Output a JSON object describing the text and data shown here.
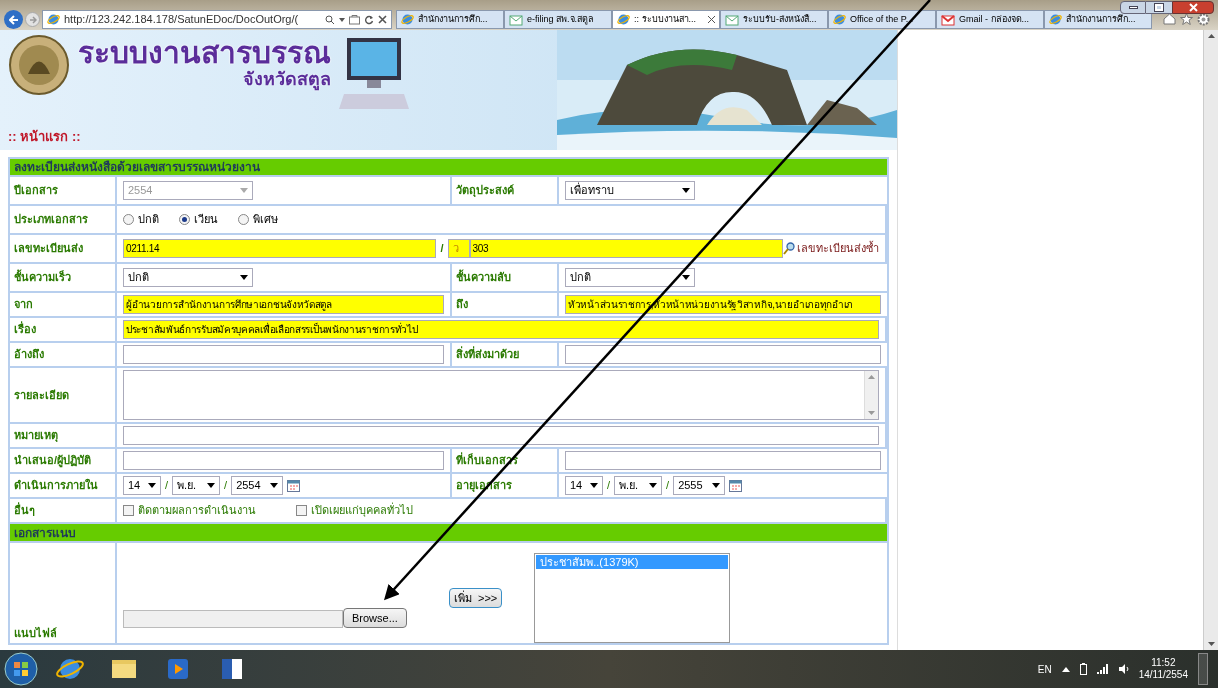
{
  "browser": {
    "address": "http://123.242.184.178/SatunEDoc/DocOutOrg/(",
    "tabs": [
      {
        "label": "สำนักงานการศึก...",
        "selected": false,
        "kind": "ie"
      },
      {
        "label": "e-filing สพ.จ.สตูล",
        "selected": false,
        "kind": "mail"
      },
      {
        "label": ":: ระบบงานสา...",
        "selected": true,
        "kind": "ie"
      },
      {
        "label": "ระบบรับ-ส่งหนังสื...",
        "selected": false,
        "kind": "mail"
      },
      {
        "label": "Office of the P...",
        "selected": false,
        "kind": "ie"
      },
      {
        "label": "Gmail - กล่องจด...",
        "selected": false,
        "kind": "gmail"
      },
      {
        "label": "สำนักงานการศึก...",
        "selected": false,
        "kind": "ie"
      }
    ]
  },
  "header": {
    "title": "ระบบงานสารบรรณ",
    "subtitle": "จังหวัดสตูล",
    "home_link": ":: หน้าแรก ::"
  },
  "form": {
    "title": "ลงทะเบียนส่งหนังสือด้วยเลขสารบรรณหน่วยงาน",
    "rows": [
      {
        "label": "ปีเอกสาร",
        "items": [
          {
            "kind": "select",
            "value": "2554",
            "disabled": true
          }
        ],
        "label2": "วัตถุประสงค์",
        "items2": [
          {
            "kind": "select",
            "value": "เพื่อทราบ",
            "disabled": false
          }
        ]
      },
      {
        "label": "ประเภทเอกสาร",
        "items": [
          {
            "kind": "radio",
            "label": "ปกติ",
            "selected": false
          },
          {
            "kind": "radio",
            "label": "เวียน",
            "selected": true
          },
          {
            "kind": "radio",
            "label": "พิเศษ",
            "selected": false
          }
        ]
      },
      {
        "label": "เลขทะเบียนส่ง",
        "items": [
          {
            "kind": "input",
            "value": "0211.14",
            "highlighted": true
          },
          {
            "kind": "slash",
            "text": "/"
          },
          {
            "kind": "short_input",
            "value": "ว",
            "highlighted": true
          },
          {
            "kind": "input",
            "value": "303",
            "highlighted": true
          },
          {
            "kind": "link",
            "text": "เลขทะเบียนส่งซ้ำ"
          }
        ]
      },
      {
        "label": "ชั้นความเร็ว",
        "items": [
          {
            "kind": "select",
            "value": "ปกติ",
            "disabled": false
          }
        ],
        "label2": "ชั้นความลับ",
        "items2": [
          {
            "kind": "select",
            "value": "ปกติ",
            "disabled": false
          }
        ]
      },
      {
        "label": "จาก",
        "items": [
          {
            "kind": "input",
            "value": "ผู้อำนวยการสำนักงานการศึกษาเอกชนจังหวัดสตูล",
            "highlighted": true
          }
        ],
        "label2": "ถึง",
        "items2": [
          {
            "kind": "input",
            "value": "หัวหน้าส่วนราชการ,หัวหน้าหน่วยงานรัฐวิสาหกิจ,นายอำเภอทุกอำเภ",
            "highlighted": true
          }
        ]
      },
      {
        "label": "เรื่อง",
        "items": [
          {
            "kind": "input",
            "value": "ประชาสัมพันธ์การรับสมัครบุคคลเพื่อเลือกสรรเป็นพนักงานราชการทั่วไป",
            "highlighted": true
          }
        ]
      },
      {
        "label": "อ้างถึง",
        "items": [
          {
            "kind": "input",
            "highlighted": false
          }
        ],
        "label2": "สิ่งที่ส่งมาด้วย",
        "items2": [
          {
            "kind": "input",
            "highlighted": false
          }
        ]
      },
      {
        "label": "รายละเอียด",
        "items": [
          {
            "kind": "textarea"
          }
        ]
      },
      {
        "label": "หมายเหตุ",
        "items": [
          {
            "kind": "input",
            "highlighted": false
          }
        ]
      },
      {
        "label": "นำเสนอ/ผู้ปฏิบัติ",
        "items": [
          {
            "kind": "input",
            "highlighted": false
          }
        ],
        "label2": "ที่เก็บเอกสาร",
        "items2": [
          {
            "kind": "input",
            "highlighted": false
          }
        ]
      },
      {
        "label": "ดำเนินการภายใน",
        "items": [
          {
            "kind": "date",
            "day": "14",
            "month": "พ.ย.",
            "year": "2554",
            "sep1": "/",
            "sep2": "/"
          }
        ],
        "label2": "อายุเอกสาร",
        "items2": [
          {
            "kind": "date",
            "day": "14",
            "month": "พ.ย.",
            "year": "2555",
            "sep1": "/",
            "sep2": "/"
          }
        ]
      },
      {
        "label": "อื่นๆ",
        "items": [
          {
            "kind": "checkbox",
            "label": "ติดตามผลการดำเนินงาน",
            "checked": false
          },
          {
            "kind": "checkbox",
            "label": "เปิดเผยแก่บุคคลทั่วไป",
            "checked": false
          }
        ]
      }
    ]
  },
  "attachments": {
    "title": "เอกสารแนบ",
    "label": "แนบไฟล์",
    "browse": "Browse...",
    "add": "เพิ่ม  >>>",
    "files": [
      {
        "name": "ประชาสัมพ..(1379K)",
        "selected": true
      }
    ]
  },
  "taskbar": {
    "language": "EN",
    "time": "11:52",
    "date": "14/11/2554"
  }
}
